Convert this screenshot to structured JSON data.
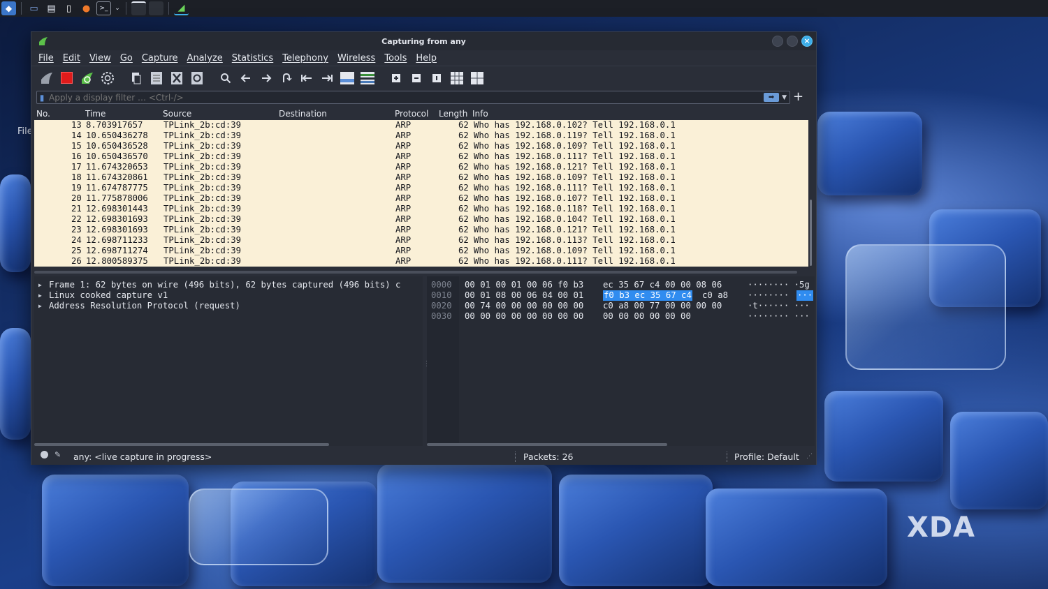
{
  "taskbar": {
    "icons": [
      "app-launcher-icon",
      "desktop-icon",
      "file-manager-icon",
      "document-icon",
      "firefox-icon",
      "terminal-icon",
      "chevron-down-icon",
      "window-icon",
      "window-icon",
      "wireshark-icon"
    ]
  },
  "desktop": {
    "file_label": "File"
  },
  "window": {
    "title": "Capturing from any",
    "close_glyph": "×"
  },
  "menu": {
    "items": [
      "File",
      "Edit",
      "View",
      "Go",
      "Capture",
      "Analyze",
      "Statistics",
      "Telephony",
      "Wireless",
      "Tools",
      "Help"
    ]
  },
  "toolbar": {
    "icons": [
      "start-capture-icon",
      "stop-capture-icon",
      "restart-capture-icon",
      "capture-options-icon",
      "open-file-icon",
      "save-file-icon",
      "close-file-icon",
      "reload-file-icon",
      "find-packet-icon",
      "go-back-icon",
      "go-forward-icon",
      "go-to-packet-icon",
      "first-packet-icon",
      "last-packet-icon",
      "auto-scroll-icon",
      "colorize-icon",
      "zoom-in-icon",
      "zoom-out-icon",
      "normal-size-icon",
      "resize-columns-icon",
      "expand-subtrees-icon"
    ]
  },
  "filter": {
    "placeholder": "Apply a display filter … <Ctrl-/>",
    "plus": "+"
  },
  "packet_list": {
    "columns": [
      "No.",
      "Time",
      "Source",
      "Destination",
      "Protocol",
      "Length",
      "Info"
    ],
    "rows": [
      {
        "no": "13",
        "time": "8.703917657",
        "source": "TPLink_2b:cd:39",
        "destination": "",
        "protocol": "ARP",
        "length": "62",
        "info": "Who has 192.168.0.102? Tell 192.168.0.1"
      },
      {
        "no": "14",
        "time": "10.650436278",
        "source": "TPLink_2b:cd:39",
        "destination": "",
        "protocol": "ARP",
        "length": "62",
        "info": "Who has 192.168.0.119? Tell 192.168.0.1"
      },
      {
        "no": "15",
        "time": "10.650436528",
        "source": "TPLink_2b:cd:39",
        "destination": "",
        "protocol": "ARP",
        "length": "62",
        "info": "Who has 192.168.0.109? Tell 192.168.0.1"
      },
      {
        "no": "16",
        "time": "10.650436570",
        "source": "TPLink_2b:cd:39",
        "destination": "",
        "protocol": "ARP",
        "length": "62",
        "info": "Who has 192.168.0.111? Tell 192.168.0.1"
      },
      {
        "no": "17",
        "time": "11.674320653",
        "source": "TPLink_2b:cd:39",
        "destination": "",
        "protocol": "ARP",
        "length": "62",
        "info": "Who has 192.168.0.121? Tell 192.168.0.1"
      },
      {
        "no": "18",
        "time": "11.674320861",
        "source": "TPLink_2b:cd:39",
        "destination": "",
        "protocol": "ARP",
        "length": "62",
        "info": "Who has 192.168.0.109? Tell 192.168.0.1"
      },
      {
        "no": "19",
        "time": "11.674787775",
        "source": "TPLink_2b:cd:39",
        "destination": "",
        "protocol": "ARP",
        "length": "62",
        "info": "Who has 192.168.0.111? Tell 192.168.0.1"
      },
      {
        "no": "20",
        "time": "11.775878006",
        "source": "TPLink_2b:cd:39",
        "destination": "",
        "protocol": "ARP",
        "length": "62",
        "info": "Who has 192.168.0.107? Tell 192.168.0.1"
      },
      {
        "no": "21",
        "time": "12.698301443",
        "source": "TPLink_2b:cd:39",
        "destination": "",
        "protocol": "ARP",
        "length": "62",
        "info": "Who has 192.168.0.118? Tell 192.168.0.1"
      },
      {
        "no": "22",
        "time": "12.698301693",
        "source": "TPLink_2b:cd:39",
        "destination": "",
        "protocol": "ARP",
        "length": "62",
        "info": "Who has 192.168.0.104? Tell 192.168.0.1"
      },
      {
        "no": "23",
        "time": "12.698301693",
        "source": "TPLink_2b:cd:39",
        "destination": "",
        "protocol": "ARP",
        "length": "62",
        "info": "Who has 192.168.0.121? Tell 192.168.0.1"
      },
      {
        "no": "24",
        "time": "12.698711233",
        "source": "TPLink_2b:cd:39",
        "destination": "",
        "protocol": "ARP",
        "length": "62",
        "info": "Who has 192.168.0.113? Tell 192.168.0.1"
      },
      {
        "no": "25",
        "time": "12.698711274",
        "source": "TPLink_2b:cd:39",
        "destination": "",
        "protocol": "ARP",
        "length": "62",
        "info": "Who has 192.168.0.109? Tell 192.168.0.1"
      },
      {
        "no": "26",
        "time": "12.800589375",
        "source": "TPLink_2b:cd:39",
        "destination": "",
        "protocol": "ARP",
        "length": "62",
        "info": "Who has 192.168.0.111? Tell 192.168.0.1"
      }
    ],
    "row_color": "#faf0d7"
  },
  "details": {
    "items": [
      "Frame 1: 62 bytes on wire (496 bits), 62 bytes captured (496 bits) c",
      "Linux cooked capture v1",
      "Address Resolution Protocol (request)"
    ]
  },
  "bytes": {
    "rows": [
      {
        "offset": "0000",
        "hex1": "00 01 00 01 00 06 f0 b3",
        "hex2": "ec 35 67 c4 00 00 08 06",
        "hex2_hl": "",
        "hex2_rest": "",
        "ascii": "········ ·5g",
        "ascii_hl": ""
      },
      {
        "offset": "0010",
        "hex1": "00 01 08 00 06 04 00 01",
        "hex2": "",
        "hex2_hl": "f0 b3 ec 35 67 c4",
        "hex2_rest": "c0 a8",
        "ascii": "········",
        "ascii_hl": "···"
      },
      {
        "offset": "0020",
        "hex1": "00 74 00 00 00 00 00 00",
        "hex2": "c0 a8 00 77 00 00 00 00",
        "hex2_hl": "",
        "hex2_rest": "",
        "ascii": "·t······ ···",
        "ascii_hl": ""
      },
      {
        "offset": "0030",
        "hex1": "00 00 00 00 00 00 00 00",
        "hex2": "00 00 00 00 00 00",
        "hex2_hl": "",
        "hex2_rest": "",
        "ascii": "········ ···",
        "ascii_hl": ""
      }
    ],
    "highlight_color": "#308cf0"
  },
  "status": {
    "capture": "any: <live capture in progress>",
    "packets": "Packets: 26",
    "profile": "Profile: Default"
  },
  "watermark": "XDA"
}
